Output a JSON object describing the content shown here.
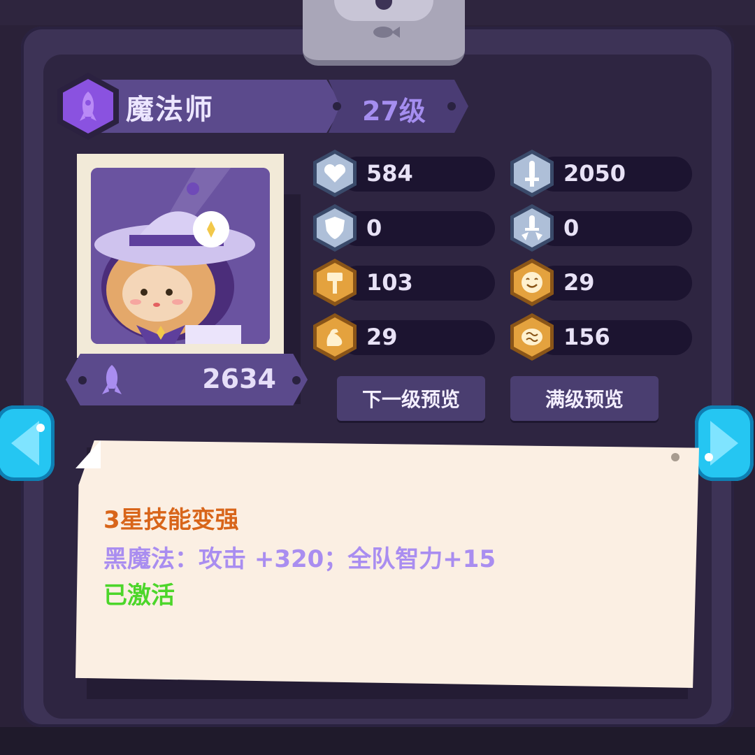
{
  "hero": {
    "class_name": "魔法师",
    "level_label": "27级",
    "power": "2634"
  },
  "stats": [
    {
      "icon": "heart-icon",
      "value": "584",
      "type": "blue"
    },
    {
      "icon": "sword-icon",
      "value": "2050",
      "type": "blue"
    },
    {
      "icon": "shield-icon",
      "value": "0",
      "type": "blue"
    },
    {
      "icon": "sword-break-icon",
      "value": "0",
      "type": "blue"
    },
    {
      "icon": "hammer-icon",
      "value": "103",
      "type": "gold"
    },
    {
      "icon": "smile-icon",
      "value": "29",
      "type": "gold"
    },
    {
      "icon": "muscle-icon",
      "value": "29",
      "type": "gold"
    },
    {
      "icon": "brain-icon",
      "value": "156",
      "type": "gold"
    }
  ],
  "buttons": {
    "next_level": "下一级预览",
    "max_level": "满级预览"
  },
  "skill": {
    "title": "3星技能变强",
    "description": "黑魔法：攻击 +320；全队智力+15",
    "status": "已激活"
  },
  "colors": {
    "panel": "#3d3356",
    "accent_purple": "#8a52e0",
    "arrow_cyan": "#25c6f2",
    "skill_title": "#d8651a",
    "skill_desc": "#a98df0",
    "skill_status": "#4cd62a"
  }
}
